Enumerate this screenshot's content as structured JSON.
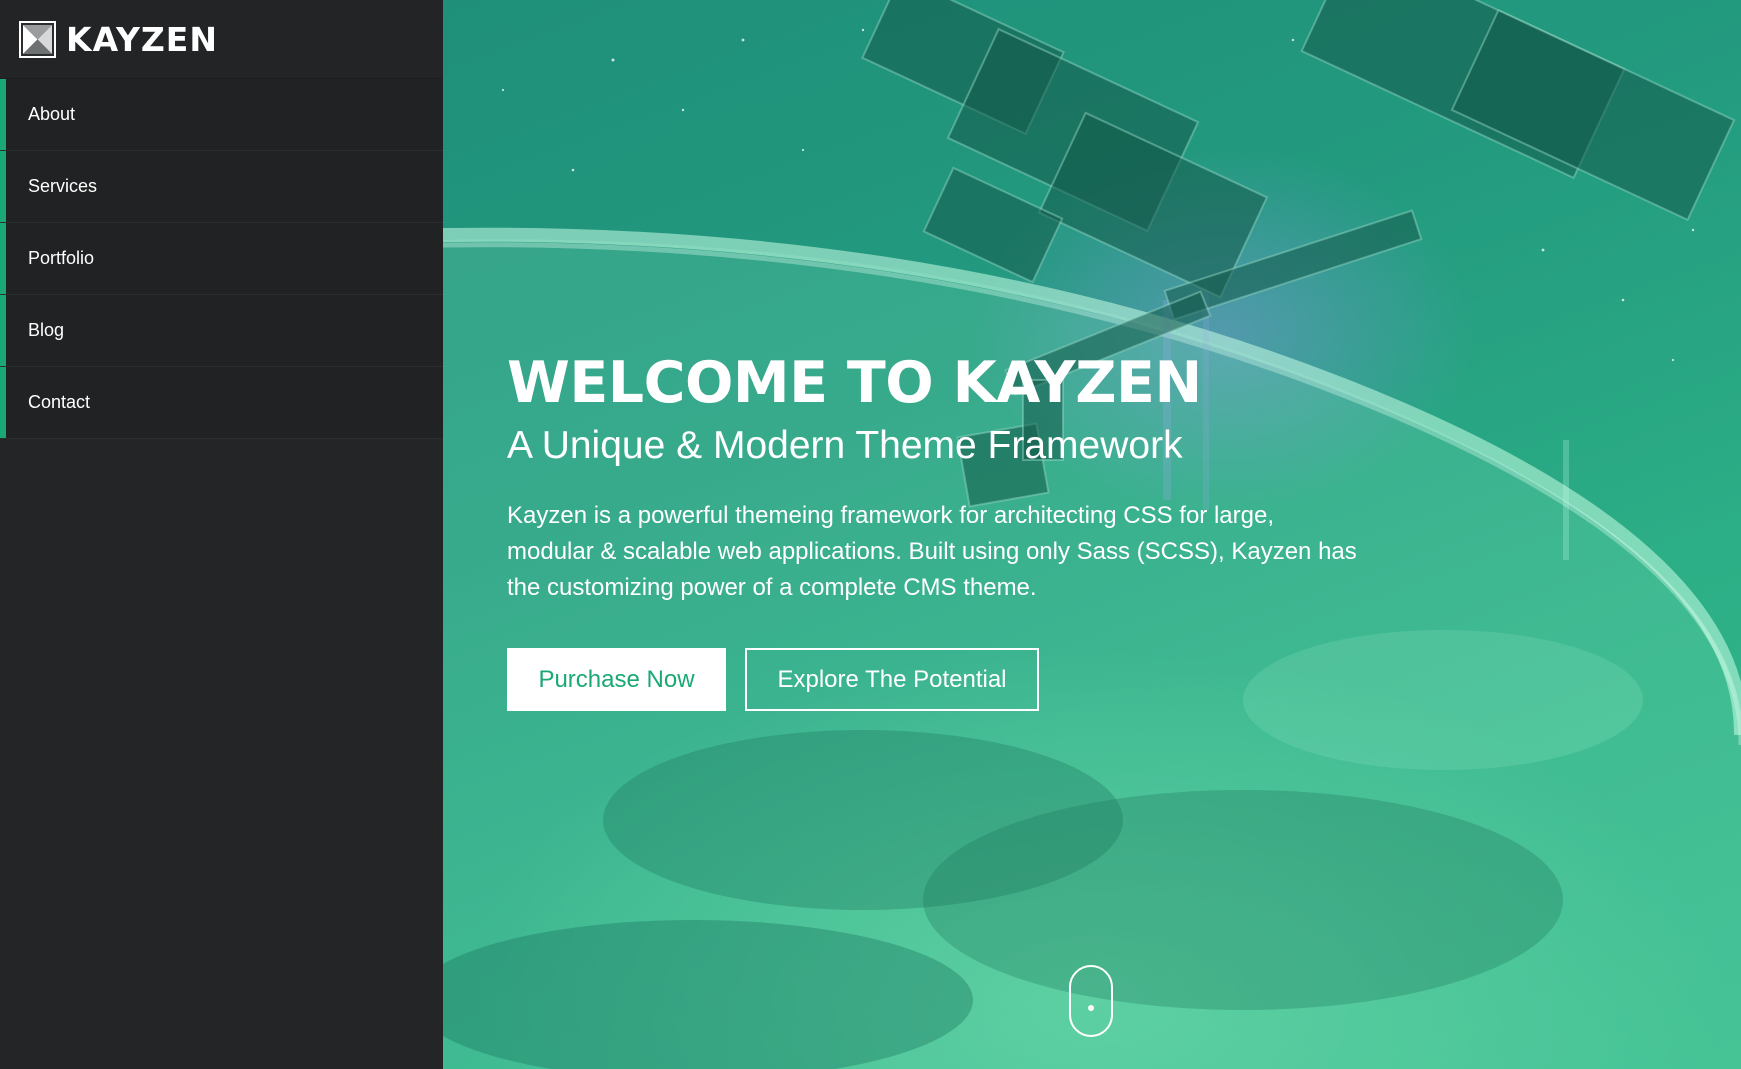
{
  "brand": {
    "logo_icon": "kayzen-logo-icon",
    "name": "KAYZEN"
  },
  "nav": {
    "items": [
      {
        "label": "About"
      },
      {
        "label": "Services"
      },
      {
        "label": "Portfolio"
      },
      {
        "label": "Blog"
      },
      {
        "label": "Contact"
      }
    ]
  },
  "hero": {
    "title": "WELCOME TO KAYZEN",
    "subtitle": "A Unique & Modern Theme Framework",
    "description": "Kayzen is a powerful themeing framework for architecting CSS for large, modular & scalable web applications. Built using only Sass (SCSS), Kayzen has the customizing power of a complete CMS theme.",
    "primary_button": "Purchase Now",
    "secondary_button": "Explore The Potential",
    "scroll_icon": "scroll-mouse-icon"
  },
  "colors": {
    "accent": "#1aa975",
    "sidebar_bg": "#232526",
    "hero_tint": "#239b7f"
  }
}
